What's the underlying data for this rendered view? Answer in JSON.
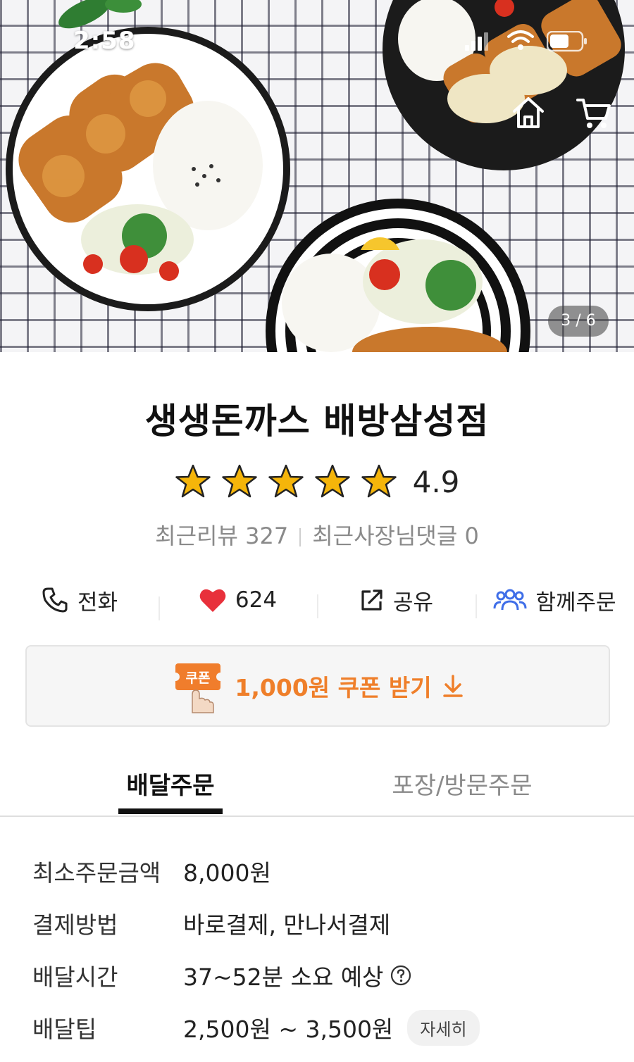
{
  "status_bar": {
    "time": "2:58"
  },
  "hero": {
    "page_indicator": "3 / 6"
  },
  "shop": {
    "name": "생생돈까스 배방삼성점",
    "rating": "4.9",
    "rating_stars": 5,
    "recent_reviews": "최근리뷰 327",
    "owner_replies": "최근사장님댓글 0"
  },
  "actions": {
    "call": "전화",
    "likes": "624",
    "share": "공유",
    "group_order": "함께주문"
  },
  "coupon": {
    "badge": "쿠폰",
    "label": "1,000원 쿠폰 받기"
  },
  "tabs": {
    "delivery": "배달주문",
    "pickup": "포장/방문주문",
    "active": "배달주문"
  },
  "info": {
    "min_order_label": "최소주문금액",
    "min_order_value": "8,000원",
    "payment_label": "결제방법",
    "payment_value": "바로결제, 만나서결제",
    "time_label": "배달시간",
    "time_value": "37~52분 소요 예상",
    "tip_label": "배달팁",
    "tip_value": "2,500원 ~ 3,500원",
    "tip_detail": "자세히"
  },
  "colors": {
    "accent_orange": "#ef7f2a",
    "heart_red": "#e8303b",
    "group_blue": "#3f6ee8",
    "star_yellow": "#f5b50a"
  }
}
